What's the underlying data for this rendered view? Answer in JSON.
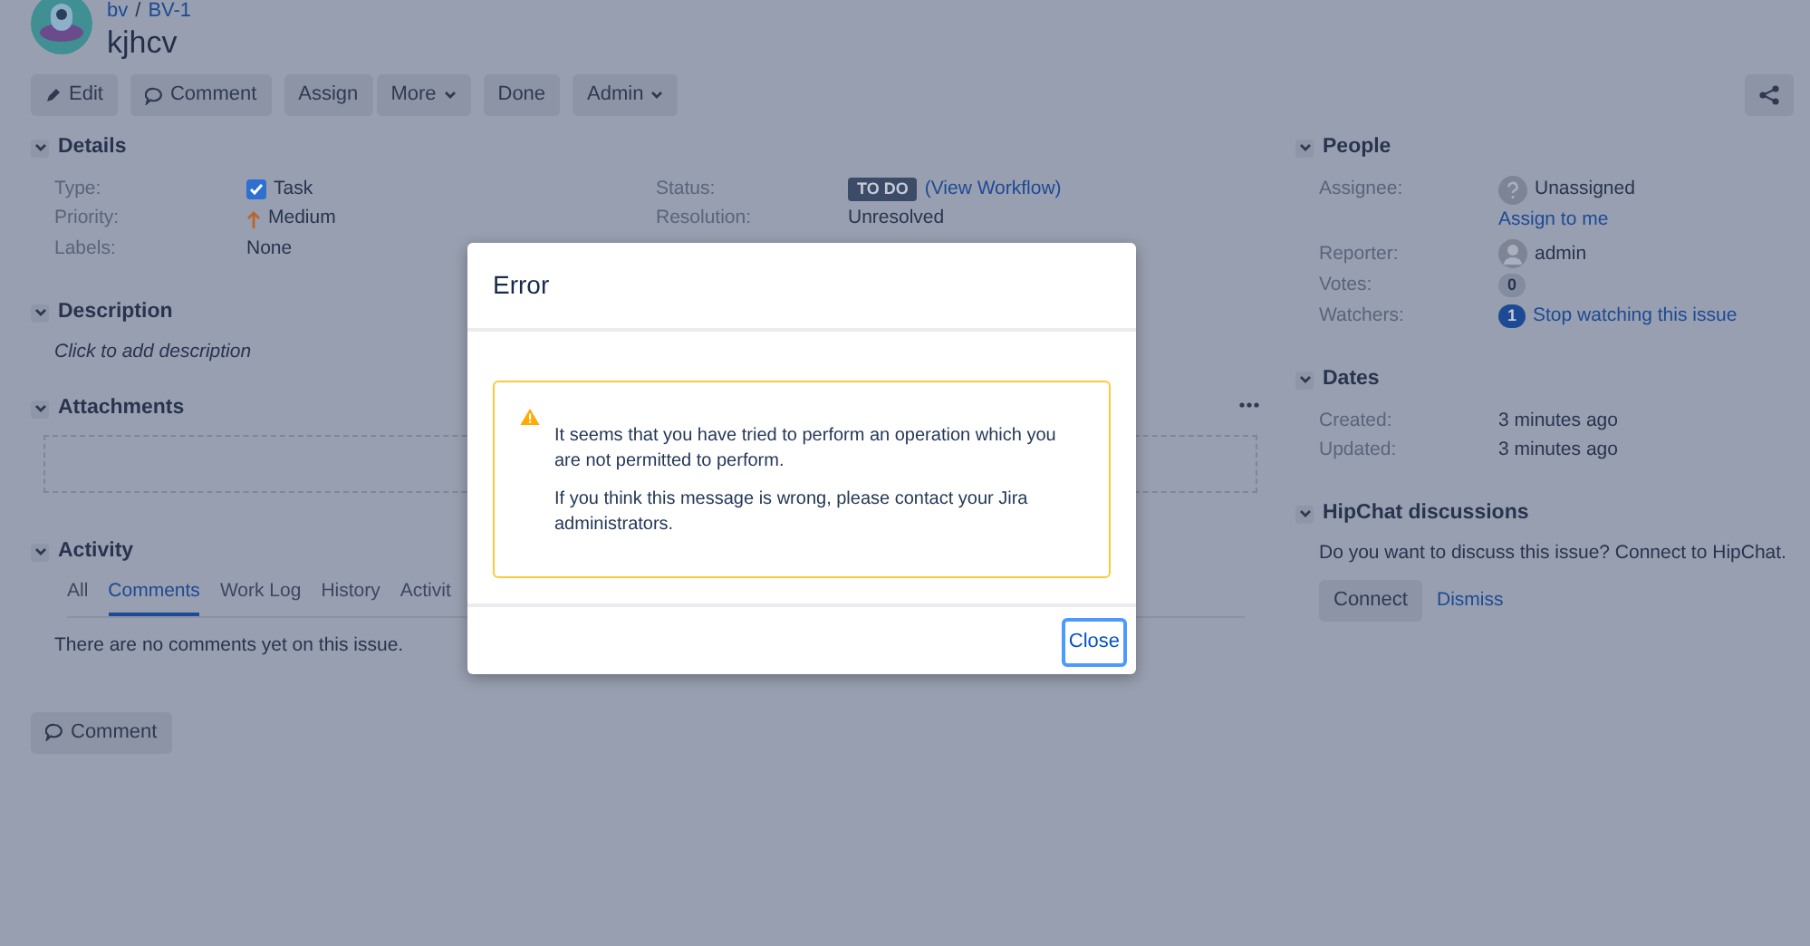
{
  "header": {
    "breadcrumbs": [
      "bv",
      "BV-1"
    ],
    "separator": "/",
    "title": "kjhcv"
  },
  "toolbar": [
    [
      {
        "label": "Edit",
        "kind": "pencil"
      }
    ],
    [
      {
        "label": "Comment",
        "kind": "speech"
      }
    ],
    [
      {
        "label": "Assign",
        "kind": "text"
      },
      {
        "label": "More",
        "kind": "menu"
      }
    ],
    [
      {
        "label": "Done",
        "kind": "text"
      }
    ],
    [
      {
        "label": "Admin",
        "kind": "menu"
      }
    ]
  ],
  "details": {
    "heading": "Details",
    "expanded": true,
    "fields_left": [
      {
        "label": "Type:",
        "value": "Task",
        "kind": "task"
      },
      {
        "label": "Priority:",
        "value": "Medium",
        "kind": "priority"
      },
      {
        "label": "Labels:",
        "value": "None",
        "kind": "text"
      }
    ],
    "fields_right": [
      {
        "label": "Status:",
        "badge": "TO DO",
        "link": "(View Workflow)",
        "kind": "status"
      },
      {
        "label": "Resolution:",
        "value": "Unresolved",
        "kind": "text"
      }
    ]
  },
  "description": {
    "heading": "Description",
    "expanded": true,
    "placeholder": "Click to add description"
  },
  "attachments": {
    "heading": "Attachments",
    "expanded": true
  },
  "activity": {
    "heading": "Activity",
    "expanded": true,
    "tabs": [
      {
        "label": "All",
        "selected": false
      },
      {
        "label": "Comments",
        "selected": true
      },
      {
        "label": "Work Log",
        "selected": false
      },
      {
        "label": "History",
        "selected": false
      },
      {
        "label": "Activit",
        "selected": false
      }
    ],
    "empty_text": "There are no comments yet on this issue.",
    "comment_button": "Comment"
  },
  "people": {
    "heading": "People",
    "expanded": true,
    "assignee": {
      "label": "Assignee:",
      "value": "Unassigned",
      "action": "Assign to me"
    },
    "reporter": {
      "label": "Reporter:",
      "value": "admin"
    },
    "votes": {
      "label": "Votes:",
      "count": "0"
    },
    "watchers": {
      "label": "Watchers:",
      "count": "1",
      "watching": true,
      "action": "Stop watching this issue"
    }
  },
  "dates": {
    "heading": "Dates",
    "expanded": true,
    "rows": [
      {
        "label": "Created:",
        "value": "3 minutes ago"
      },
      {
        "label": "Updated:",
        "value": "3 minutes ago"
      }
    ]
  },
  "hipchat": {
    "heading": "HipChat discussions",
    "expanded": true,
    "text": "Do you want to discuss this issue? Connect to HipChat.",
    "buttons": [
      {
        "label": "Connect",
        "kind": "button"
      },
      {
        "label": "Dismiss",
        "kind": "link"
      }
    ]
  },
  "dialog": {
    "title": "Error",
    "messages": [
      "It seems that you have tried to perform an operation which you are not permitted to perform.",
      "If you think this message is wrong, please contact your Jira administrators."
    ],
    "close": {
      "label": "Close",
      "focused": true
    }
  }
}
